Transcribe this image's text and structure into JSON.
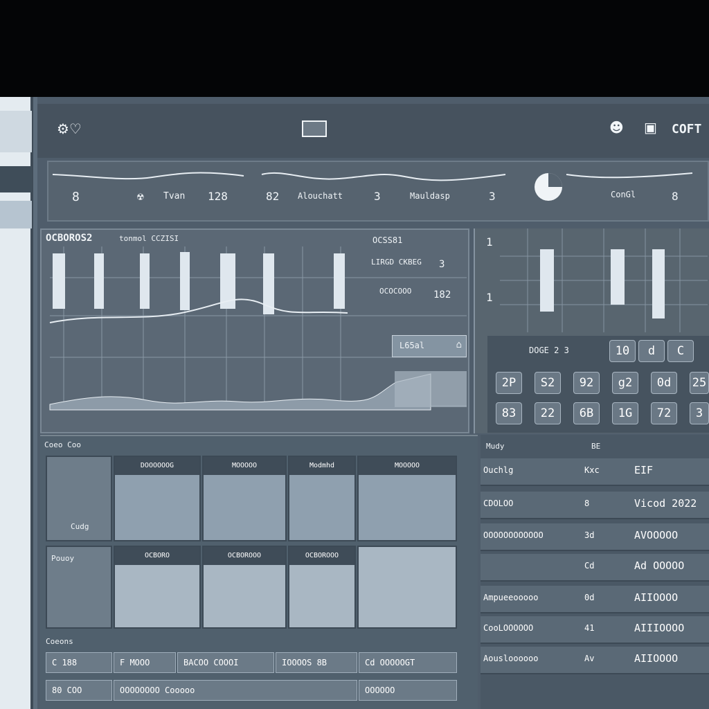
{
  "topbar": {
    "left_icon": "gear-heart-icon",
    "center_icon": "window-icon",
    "right_icons": [
      "face-icon",
      "briefcase-icon"
    ],
    "right_label": "COFT"
  },
  "metrics": {
    "items": [
      {
        "num": "8",
        "label": "Tvan",
        "val": "128"
      },
      {
        "num": "82",
        "label": "Alouchatt",
        "val": "3"
      },
      {
        "num": "3",
        "label": "Mauldasp",
        "val": "3"
      },
      {
        "num": "",
        "label": "ConGl",
        "val": "8"
      }
    ]
  },
  "chart": {
    "title": "OCBOROS2",
    "subtitle": "tonmol CCZISI",
    "side_labels": [
      "OCSS81",
      "LIRGD CKBEG",
      "OCOCOOO"
    ],
    "side_values": [
      "",
      "3",
      "182"
    ],
    "badge": "L65al"
  },
  "rpanel": {
    "numbers": [
      "1",
      "1"
    ],
    "header": "DOGE 2 3",
    "tabs": [
      "10",
      "d",
      "C"
    ]
  },
  "keypad": {
    "row1": [
      "2P",
      "S2",
      "92",
      "g2",
      "0d",
      "25"
    ],
    "row2": [
      "83",
      "22",
      "6B",
      "1G",
      "72",
      "3"
    ]
  },
  "tiles": {
    "header": "Coeo Coo",
    "left_cards": [
      "Cudg",
      "Pouoy"
    ],
    "top_caps": [
      "DOOOOOOG",
      "MOOOOO",
      "Modmhd",
      "MOOOOO"
    ],
    "bot_caps": [
      "OCBORO",
      "OCBOROOO",
      "OCBOROOO"
    ],
    "footer_label": "Coeons",
    "footer_row1": [
      "C 188",
      "F MOOO",
      "BACOO COOOI",
      "IOOOOS 8B",
      "Cd OOOOOGT"
    ],
    "footer_row2": [
      "80 COO",
      "OOOOOOOO Cooooo",
      "OOOOOO"
    ]
  },
  "rtable": {
    "header": "Mudy",
    "header_val": "BE",
    "rows": [
      {
        "a": "Ouchlg",
        "b": "Kxc",
        "c": "EIF"
      },
      {
        "a": "CDOLOO",
        "b": "8",
        "c": "Vicod 2022"
      },
      {
        "a": "OOOOOOOOOOOO",
        "b": "3d",
        "c": "AVOOOOO"
      },
      {
        "a": "",
        "b": "Cd",
        "c": "Ad OOOOO"
      },
      {
        "a": "Ampueeooooo",
        "b": "0d",
        "c": "AIIOOOO"
      },
      {
        "a": "CooLOOOOOO",
        "b": "41",
        "c": "AIIIOOOO"
      },
      {
        "a": "Aousloooooo",
        "b": "Av",
        "c": "AIIOOOO"
      }
    ]
  }
}
